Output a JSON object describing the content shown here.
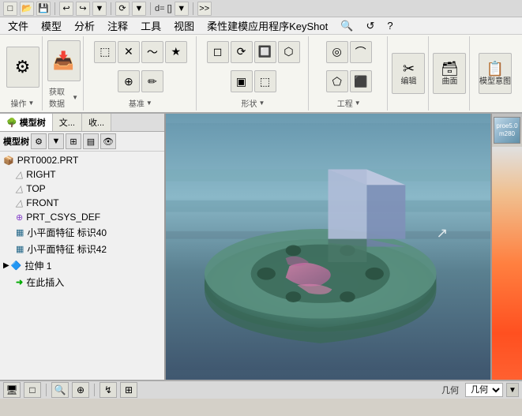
{
  "titlebar": {
    "icon": "■",
    "controls": [
      "_",
      "□",
      "×"
    ]
  },
  "quickaccess": {
    "buttons": [
      "□",
      "↩",
      "↪",
      "▼",
      "●",
      "▼",
      "⚙",
      "▼",
      "d=[]",
      "▼",
      ">>"
    ]
  },
  "menubar": {
    "items": [
      "文件",
      "模型",
      "分析",
      "注释",
      "工具",
      "视图",
      "柔性建模应用程序KeyShot",
      "🔍",
      "↺",
      "?"
    ]
  },
  "ribbon": {
    "sections": [
      {
        "name": "操作",
        "label": "操作",
        "tools": [
          "⚙",
          "▼"
        ]
      },
      {
        "name": "获取数据",
        "label": "获取数据",
        "tools": [
          "📥",
          "▼"
        ]
      },
      {
        "name": "基准",
        "label": "基准",
        "sublabel": "▼",
        "tools": [
          "⬚",
          "✕",
          "⬚",
          "★",
          "⬛",
          "⬚",
          "⬚",
          "⬚"
        ]
      },
      {
        "name": "形状",
        "label": "形状",
        "sublabel": "▼",
        "tools": [
          "◻",
          "⬚",
          "🔲",
          "⬡",
          "▣",
          "⬚",
          "⬚",
          "⬚"
        ]
      },
      {
        "name": "工程",
        "label": "工程",
        "sublabel": "▼",
        "tools": [
          "⬚",
          "⬚",
          "⬚",
          "⬚"
        ]
      },
      {
        "name": "编辑",
        "label": "编辑",
        "tools": [
          "⬚"
        ]
      },
      {
        "name": "曲面",
        "label": "曲面",
        "tools": [
          "⬚"
        ]
      },
      {
        "name": "模型意图",
        "label": "模型意图",
        "tools": [
          "⬚"
        ]
      }
    ]
  },
  "leftpanel": {
    "tabs": [
      {
        "label": "模型树",
        "icon": "🌳",
        "active": true
      },
      {
        "label": "文...",
        "icon": "📄",
        "active": false
      },
      {
        "label": "收...",
        "icon": "★",
        "active": false
      }
    ],
    "toolbar_label": "模型树",
    "tree_items": [
      {
        "label": "PRT0002.PRT",
        "icon": "📦",
        "level": 0,
        "type": "part"
      },
      {
        "label": "RIGHT",
        "icon": "△",
        "level": 1,
        "type": "datum"
      },
      {
        "label": "TOP",
        "icon": "△",
        "level": 1,
        "type": "datum"
      },
      {
        "label": "FRONT",
        "icon": "△",
        "level": 1,
        "type": "datum"
      },
      {
        "label": "PRT_CSYS_DEF",
        "icon": "⊕",
        "level": 1,
        "type": "csys"
      },
      {
        "label": "小平面特征 标识40",
        "icon": "▦",
        "level": 1,
        "type": "feature"
      },
      {
        "label": "小平面特征 标识42",
        "icon": "▦",
        "level": 1,
        "type": "feature"
      },
      {
        "label": "拉伸 1",
        "icon": "▷",
        "level": 0,
        "type": "extrude",
        "arrow": true
      },
      {
        "label": "在此插入",
        "icon": "➜",
        "level": 1,
        "type": "insert"
      }
    ]
  },
  "viewport": {
    "background_colors": [
      "#6a9ab0",
      "#8ab8c8",
      "#7098a8",
      "#5a8090",
      "#486878"
    ],
    "model_description": "3D CAD model of mechanical part with flange and rectangular protrusion"
  },
  "rightpanel": {
    "label": "proe5.0\nm280"
  },
  "statusbar": {
    "buttons": [
      "🖥",
      "□",
      "↯",
      "🔍",
      "⊕"
    ],
    "mode_label": "几何",
    "arrow": "▼"
  }
}
